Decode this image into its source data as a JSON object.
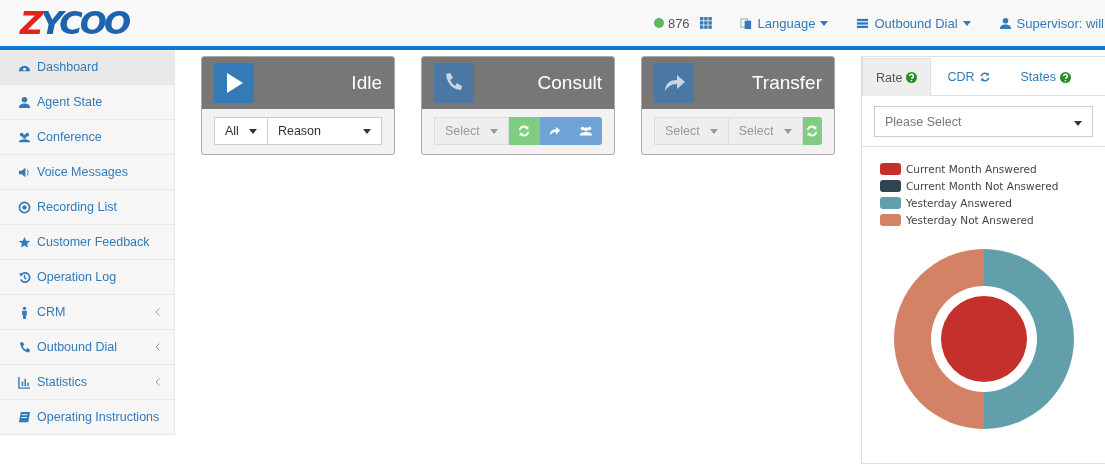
{
  "header": {
    "logo": [
      {
        "text": "Z",
        "color": "#e0261c"
      },
      {
        "text": "YCOO",
        "color": "#1d63ad"
      }
    ],
    "extension": {
      "number": "876",
      "online": true
    },
    "menus": [
      {
        "label": "Language",
        "kind": "language"
      },
      {
        "label": "Outbound Dial",
        "kind": "dial"
      },
      {
        "label": "Supervisor: will",
        "kind": "user"
      }
    ]
  },
  "sidebar": {
    "items": [
      {
        "label": "Dashboard",
        "selected": true,
        "kind": "link"
      },
      {
        "label": "Agent State",
        "selected": false,
        "kind": "link"
      },
      {
        "label": "Conference",
        "selected": false,
        "kind": "link"
      },
      {
        "label": "Voice Messages",
        "selected": false,
        "kind": "link"
      },
      {
        "label": "Recording List",
        "selected": false,
        "kind": "link"
      },
      {
        "label": "Customer Feedback",
        "selected": false,
        "kind": "link"
      },
      {
        "label": "Operation Log",
        "selected": false,
        "kind": "link"
      },
      {
        "label": "CRM",
        "selected": false,
        "kind": "submenu"
      },
      {
        "label": "Outbound Dial",
        "selected": false,
        "kind": "submenu"
      },
      {
        "label": "Statistics",
        "selected": false,
        "kind": "submenu"
      },
      {
        "label": "Operating Instructions",
        "selected": false,
        "kind": "link"
      }
    ]
  },
  "cards": [
    {
      "title": "Idle",
      "kind": "play",
      "active": true,
      "controls": [
        {
          "kind": "select",
          "label": "All",
          "disabled": false
        },
        {
          "kind": "select",
          "label": "Reason",
          "disabled": false
        }
      ]
    },
    {
      "title": "Consult",
      "kind": "phone",
      "active": false,
      "controls": [
        {
          "kind": "select",
          "label": "Select",
          "disabled": true
        },
        {
          "kind": "refresh",
          "color": "#80cc80"
        },
        {
          "kind": "forward",
          "color": "#6fa3d6"
        },
        {
          "kind": "group",
          "color": "#6fa3d6"
        }
      ]
    },
    {
      "title": "Transfer",
      "kind": "forward",
      "active": false,
      "controls": [
        {
          "kind": "select",
          "label": "Select",
          "disabled": true
        },
        {
          "kind": "select",
          "label": "Select",
          "disabled": true
        },
        {
          "kind": "refresh",
          "color": "#80cc80"
        }
      ]
    }
  ],
  "stats_panel": {
    "tabs": [
      {
        "label": "Rate",
        "selected": true,
        "kind": "help"
      },
      {
        "label": "CDR",
        "selected": false,
        "kind": "refresh"
      },
      {
        "label": "States",
        "selected": false,
        "kind": "help"
      }
    ],
    "select": {
      "placeholder": "Please Select"
    },
    "legend": [
      {
        "label": "Current Month Answered",
        "color": "#c4302b"
      },
      {
        "label": "Current Month Not Answered",
        "color": "#2e4453"
      },
      {
        "label": "Yesterday Answered",
        "color": "#61a0aa"
      },
      {
        "label": "Yesterday Not Answered",
        "color": "#d48265"
      }
    ]
  }
}
